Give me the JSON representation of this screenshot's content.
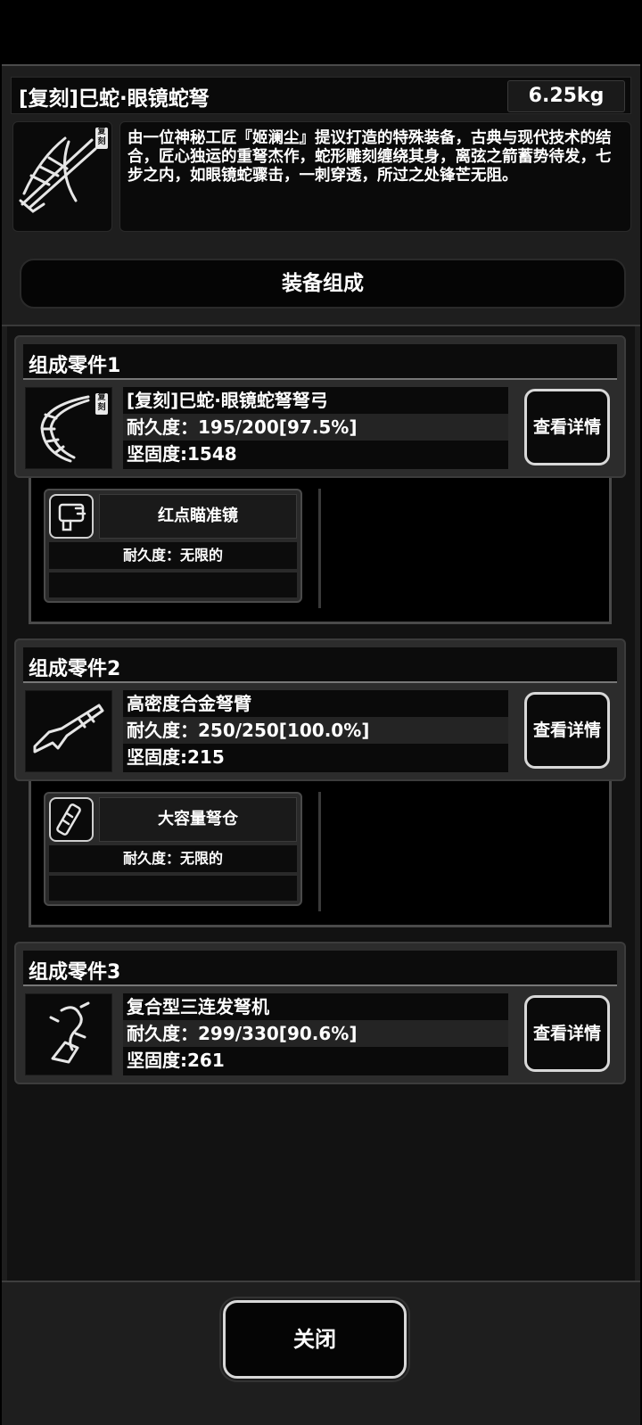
{
  "item": {
    "title": "[复刻]巳蛇·眼镜蛇弩",
    "weight": "6.25kg",
    "description": "由一位神秘工匠『姬澜尘』提议打造的特殊装备，古典与现代技术的结合，匠心独运的重弩杰作，蛇形雕刻缠绕其身，离弦之箭蓄势待发，七步之内，如眼镜蛇骤击，一刺穿透，所过之处锋芒无阻。",
    "badge": "复刻",
    "icon": "crossbow-icon"
  },
  "section_title": "装备组成",
  "detail_label": "查看详情",
  "parts": [
    {
      "header": "组成零件1",
      "name": "[复刻]巳蛇·眼镜蛇弩弩弓",
      "durability": "耐久度：195/200[97.5%]",
      "firmness": "坚固度:1548",
      "icon": "crossbow-bow-icon",
      "badge": "复刻",
      "attachment": {
        "name": "红点瞄准镜",
        "durability": "耐久度：无限的",
        "icon": "red-dot-sight-icon"
      }
    },
    {
      "header": "组成零件2",
      "name": "高密度合金弩臂",
      "durability": "耐久度：250/250[100.0%]",
      "firmness": "坚固度:215",
      "icon": "crossbow-stock-icon",
      "attachment": {
        "name": "大容量弩仓",
        "durability": "耐久度：无限的",
        "icon": "magazine-icon"
      }
    },
    {
      "header": "组成零件3",
      "name": "复合型三连发弩机",
      "durability": "耐久度：299/330[90.6%]",
      "firmness": "坚固度:261",
      "icon": "trigger-mechanism-icon"
    }
  ],
  "close_label": "关闭"
}
